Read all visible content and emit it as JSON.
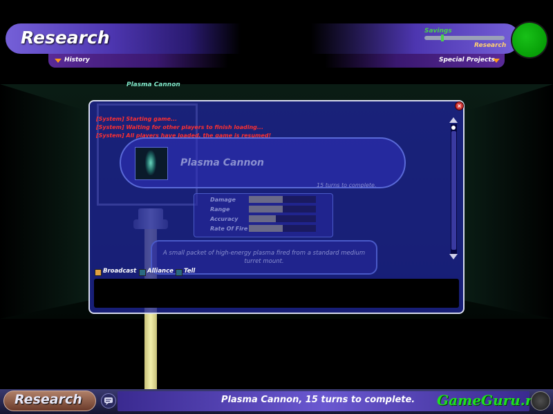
{
  "header": {
    "title": "Research",
    "savings_label": "Savings",
    "research_label": "Research",
    "savings_level": 0.22
  },
  "tabs": {
    "history": "History",
    "special_projects": "Special Projects"
  },
  "scene": {
    "selected_weapon": "Plasma Cannon"
  },
  "chat": {
    "messages": [
      "[System] Starting game...",
      "[System] Waiting for other players to finish loading...",
      "[System] All players have loaded, the game is resumed!"
    ],
    "channels": [
      "Broadcast",
      "Alliance",
      "Tell"
    ],
    "close_glyph": "×",
    "colors": {
      "system_message": "#ff3030",
      "broadcast": "#e0a040",
      "alliance": "#2a6a80",
      "tell": "#2a6a80"
    }
  },
  "item": {
    "name": "Plasma Cannon",
    "turns": "15 turns to complete.",
    "stats": [
      {
        "label": "Damage",
        "value": 0.5
      },
      {
        "label": "Range",
        "value": 0.5
      },
      {
        "label": "Accuracy",
        "value": 0.4
      },
      {
        "label": "Rate Of Fire",
        "value": 0.5
      }
    ],
    "description": "A small packet of high-energy plasma fired from a standard medium turret mount."
  },
  "footer": {
    "research_button": "Research",
    "status": "Plasma Cannon, 15 turns to complete.",
    "watermark": "GameGuru.ru"
  }
}
